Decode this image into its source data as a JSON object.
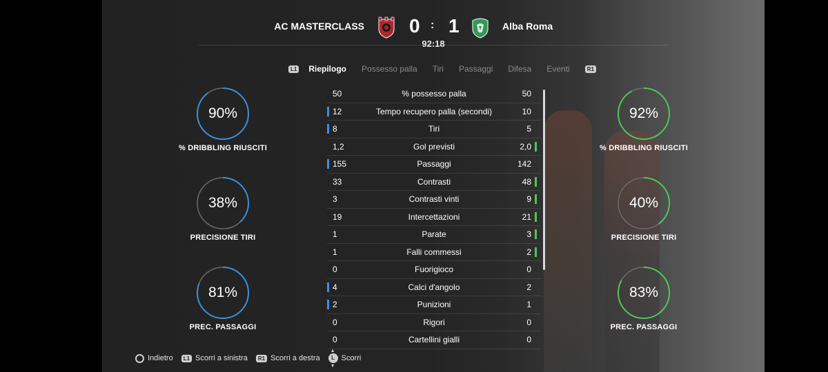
{
  "match": {
    "home_team": "AC MASTERCLASS",
    "away_team": "Alba Roma",
    "home_score": "0",
    "separator": ":",
    "away_score": "1",
    "clock": "92:18",
    "colors": {
      "home": "#b0262e",
      "away": "#2f9a52"
    }
  },
  "tabs": {
    "left_button": "L1",
    "right_button": "R1",
    "items": [
      "Riepilogo",
      "Possesso palla",
      "Tiri",
      "Passaggi",
      "Difesa",
      "Eventi"
    ],
    "active": "Riepilogo"
  },
  "home_rings": [
    {
      "value": "90%",
      "fraction": 0.9,
      "label": "% DRIBBLING RIUSCITI"
    },
    {
      "value": "38%",
      "fraction": 0.38,
      "label": "PRECISIONE TIRI"
    },
    {
      "value": "81%",
      "fraction": 0.81,
      "label": "PREC. PASSAGGI"
    }
  ],
  "away_rings": [
    {
      "value": "92%",
      "fraction": 0.92,
      "label": "% DRIBBLING RIUSCITI"
    },
    {
      "value": "40%",
      "fraction": 0.4,
      "label": "PRECISIONE TIRI"
    },
    {
      "value": "83%",
      "fraction": 0.83,
      "label": "PREC. PASSAGGI"
    }
  ],
  "ring_colors": {
    "home": "#3b8fe0",
    "away": "#4cc85a",
    "track": "#6a6a6a"
  },
  "stats": [
    {
      "name": "% possesso palla",
      "home": "50",
      "away": "50",
      "leader": "none"
    },
    {
      "name": "Tempo recupero palla (secondi)",
      "home": "12",
      "away": "10",
      "leader": "home"
    },
    {
      "name": "Tiri",
      "home": "8",
      "away": "5",
      "leader": "home"
    },
    {
      "name": "Gol previsti",
      "home": "1,2",
      "away": "2,0",
      "leader": "away"
    },
    {
      "name": "Passaggi",
      "home": "155",
      "away": "142",
      "leader": "home"
    },
    {
      "name": "Contrasti",
      "home": "33",
      "away": "48",
      "leader": "away"
    },
    {
      "name": "Contrasti vinti",
      "home": "3",
      "away": "9",
      "leader": "away"
    },
    {
      "name": "Intercettazioni",
      "home": "19",
      "away": "21",
      "leader": "away"
    },
    {
      "name": "Parate",
      "home": "1",
      "away": "3",
      "leader": "away"
    },
    {
      "name": "Falli commessi",
      "home": "1",
      "away": "2",
      "leader": "away"
    },
    {
      "name": "Fuorigioco",
      "home": "0",
      "away": "0",
      "leader": "none"
    },
    {
      "name": "Calci d'angolo",
      "home": "4",
      "away": "2",
      "leader": "home"
    },
    {
      "name": "Punizioni",
      "home": "2",
      "away": "1",
      "leader": "home"
    },
    {
      "name": "Rigori",
      "home": "0",
      "away": "0",
      "leader": "none"
    },
    {
      "name": "Cartellini gialli",
      "home": "0",
      "away": "0",
      "leader": "none"
    }
  ],
  "footer": {
    "back": {
      "icon": "circle-button-icon",
      "label": "Indietro"
    },
    "scroll_left": {
      "button": "L1",
      "label": "Scorri a sinistra"
    },
    "scroll_right": {
      "button": "R1",
      "label": "Scorri a destra"
    },
    "scroll": {
      "button": "L",
      "label": "Scorri"
    }
  }
}
